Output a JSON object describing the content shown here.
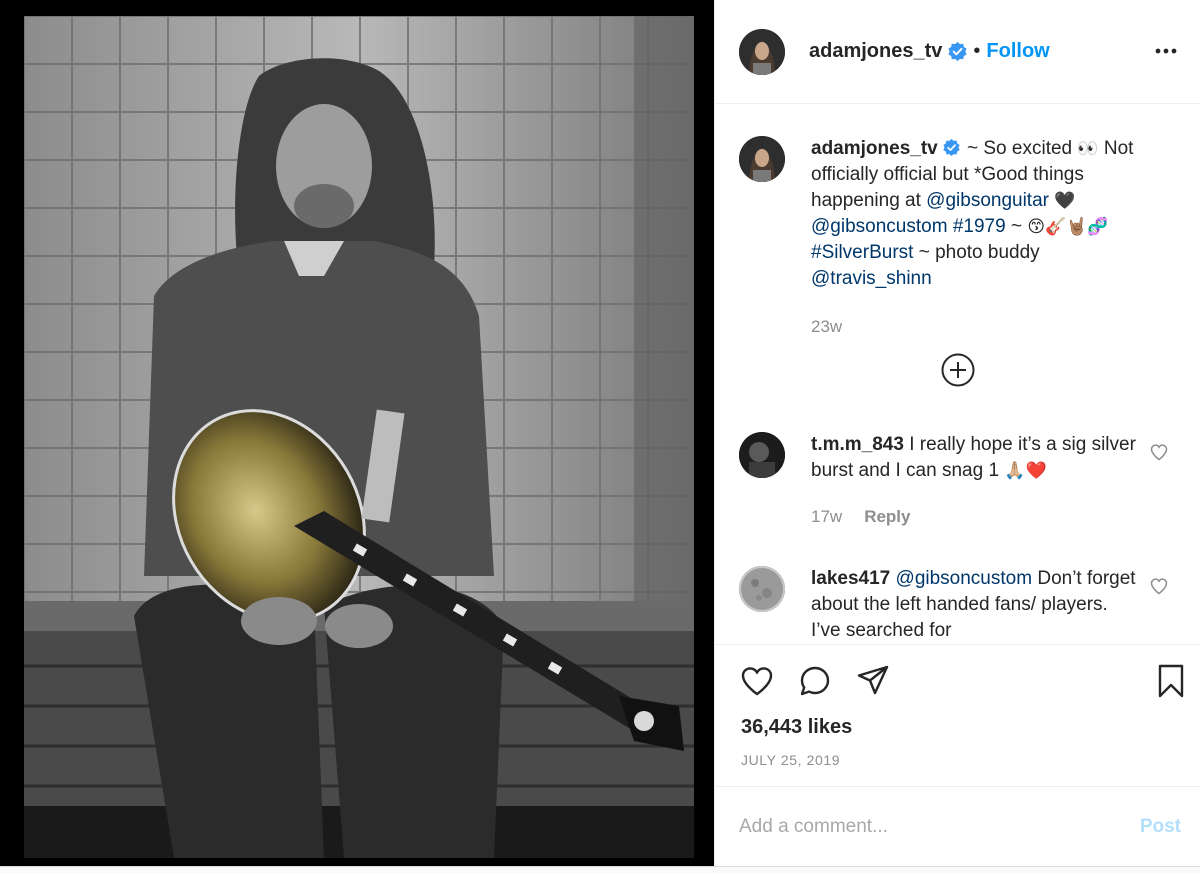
{
  "post": {
    "author": "adamjones_tv",
    "follow_label": "Follow",
    "dot": "•",
    "likes": "36,443 likes",
    "date": "JULY 25, 2019"
  },
  "caption": {
    "username": "adamjones_tv",
    "segments": [
      {
        "t": " ~ So excited ",
        "k": "text"
      },
      {
        "t": "👀",
        "k": "emoji"
      },
      {
        "t": " Not officially official but *Good things happening at ",
        "k": "text"
      },
      {
        "t": "@gibsonguitar",
        "k": "link"
      },
      {
        "t": " 🖤 ",
        "k": "emoji"
      },
      {
        "t": "@gibsoncustom",
        "k": "link"
      },
      {
        "t": " ",
        "k": "text"
      },
      {
        "t": "#1979",
        "k": "link"
      },
      {
        "t": " ~ ",
        "k": "text"
      },
      {
        "t": "😙🎸🤘🏽🧬",
        "k": "emoji"
      },
      {
        "t": " ",
        "k": "text"
      },
      {
        "t": "#SilverBurst",
        "k": "link"
      },
      {
        "t": " ~ photo buddy ",
        "k": "text"
      },
      {
        "t": "@travis_shinn",
        "k": "link"
      }
    ],
    "time": "23w"
  },
  "comments": [
    {
      "username": "t.m.m_843",
      "text": " I really hope it’s a sig silver burst and I can snag 1 ",
      "emoji": "🙏🏼❤️",
      "time": "17w",
      "reply_label": "Reply"
    },
    {
      "username": "lakes417",
      "mention": "@gibsoncustom",
      "text": " Don’t forget about the left handed fans/ players. I’ve searched for"
    }
  ],
  "add_comment": {
    "placeholder": "Add a comment...",
    "post_label": "Post"
  },
  "colors": {
    "accent": "#0095f6",
    "link": "#00376b",
    "muted": "#8e8e8e",
    "post_disabled": "#b2dffc"
  },
  "icons": [
    "verified-badge-icon",
    "more-options-icon",
    "plus-circle-icon",
    "heart-icon",
    "comment-icon",
    "share-icon",
    "bookmark-icon"
  ]
}
